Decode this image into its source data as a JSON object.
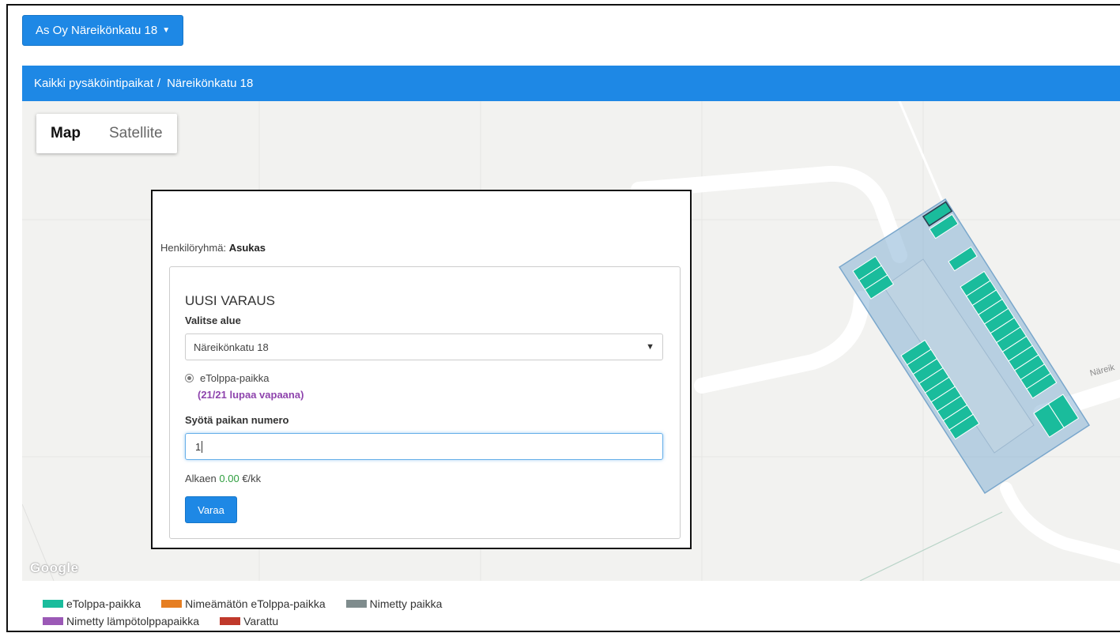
{
  "header": {
    "org_selector": "As Oy Näreikönkatu 18"
  },
  "breadcrumb": {
    "root": "Kaikki pysäköintipaikat",
    "separator": "/",
    "current": "Näreikönkatu 18"
  },
  "map": {
    "tabs": [
      {
        "label": "Map"
      },
      {
        "label": "Satellite"
      }
    ],
    "street_label": "Näreik",
    "attribution": "Google"
  },
  "modal": {
    "group_label": "Henkilöryhmä:",
    "group_value": "Asukas",
    "title": "UUSI VARAUS",
    "area_label": "Valitse alue",
    "area_selected": "Näreikönkatu 18",
    "radio_label": "eTolppa-paikka",
    "availability": "(21/21 lupaa vapaana)",
    "spot_label": "Syötä paikan numero",
    "spot_value": "1",
    "price_prefix": "Alkaen",
    "price_value": "0.00",
    "price_unit": "€/kk",
    "submit_label": "Varaa"
  },
  "legend": {
    "items": [
      {
        "label": "eTolppa-paikka",
        "color": "#1abc9c"
      },
      {
        "label": "Nimeämätön eTolppa-paikka",
        "color": "#e67e22"
      },
      {
        "label": "Nimetty paikka",
        "color": "#7f8c8d"
      },
      {
        "label": "Nimetty lämpötolppapaikka",
        "color": "#9b59b6"
      },
      {
        "label": "Varattu",
        "color": "#c0392b"
      }
    ]
  }
}
